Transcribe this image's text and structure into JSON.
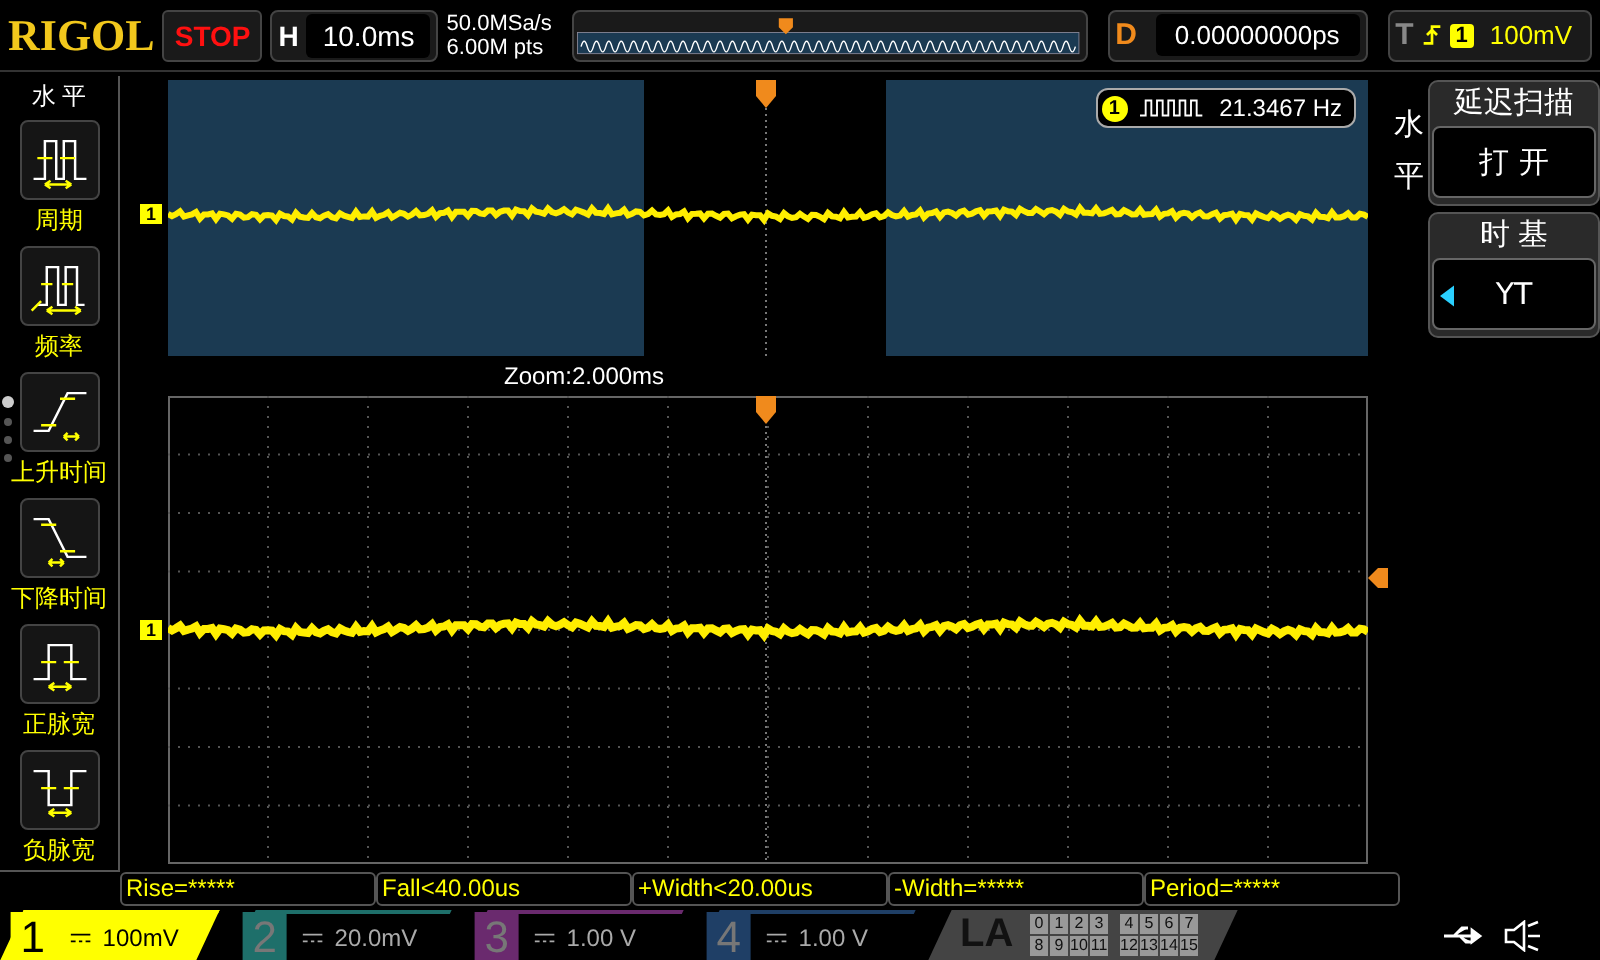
{
  "header": {
    "logo": "RIGOL",
    "run_state": "STOP",
    "timebase_label": "H",
    "timebase": "10.0ms",
    "sample_rate": "50.0MSa/s",
    "memory_depth": "6.00M pts",
    "delay_label": "D",
    "delay": "0.00000000ps",
    "trigger_label": "T",
    "trigger_source": "1",
    "trigger_level": "100mV"
  },
  "left_menu": {
    "title": "水 平",
    "items": [
      {
        "label": "周期",
        "kind": "period"
      },
      {
        "label": "频率",
        "kind": "frequency"
      },
      {
        "label": "上升时间",
        "kind": "rise"
      },
      {
        "label": "下降时间",
        "kind": "fall"
      },
      {
        "label": "正脉宽",
        "kind": "pos-width"
      },
      {
        "label": "负脉宽",
        "kind": "neg-width"
      }
    ],
    "pages": [
      {
        "selected": true
      },
      {
        "selected": false
      },
      {
        "selected": false
      },
      {
        "selected": false
      }
    ]
  },
  "overview": {
    "channel_marker": "1",
    "frequency_channel": "1",
    "frequency": "21.3467 Hz",
    "zoom_label": "Zoom:2.000ms"
  },
  "zoom_view": {
    "channel_marker": "1"
  },
  "right_panel": {
    "title": "水平",
    "sections": [
      {
        "title": "延迟扫描",
        "value": "打 开",
        "kind": "plain"
      },
      {
        "title": "时 基",
        "value": "YT",
        "kind": "cycle"
      }
    ]
  },
  "measurements": [
    "Rise=*****",
    "Fall<40.00us",
    "+Width<20.00us",
    "-Width=*****",
    "Period=*****"
  ],
  "channels": [
    {
      "number": "1",
      "scale": "100mV",
      "color": "#ffff00",
      "active": true
    },
    {
      "number": "2",
      "scale": "20.0mV",
      "color": "#1e6f6a",
      "active": false
    },
    {
      "number": "3",
      "scale": "1.00 V",
      "color": "#6a2a6e",
      "active": false
    },
    {
      "number": "4",
      "scale": "1.00 V",
      "color": "#1f3f66",
      "active": false
    }
  ],
  "la": {
    "label": "LA",
    "bits": [
      "0",
      "1",
      "2",
      "3",
      "4",
      "5",
      "6",
      "7",
      "8",
      "9",
      "10",
      "11",
      "12",
      "13",
      "14",
      "15"
    ]
  }
}
